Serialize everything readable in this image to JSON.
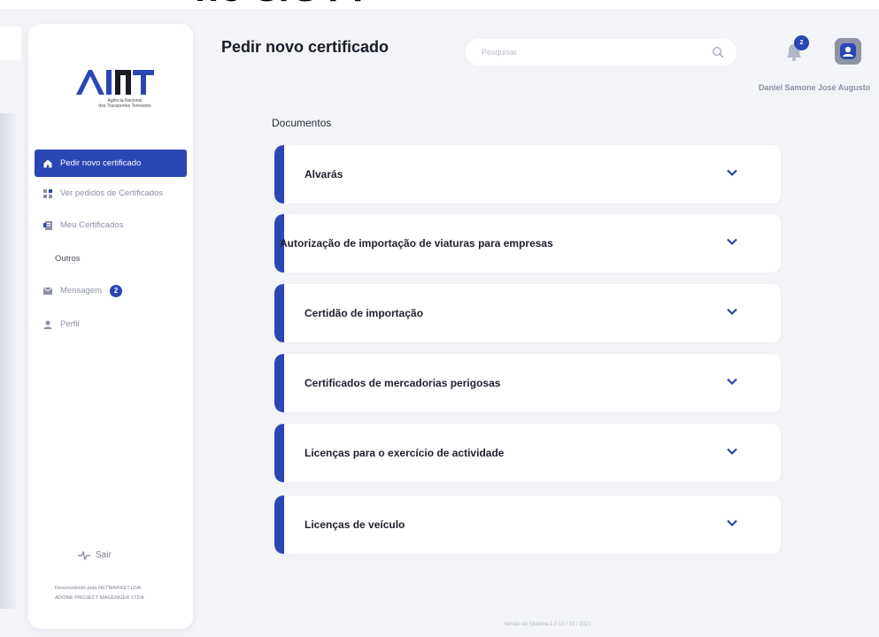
{
  "background": {
    "cut_text": "no siGTT"
  },
  "brand": {
    "logo_text": "ANTT",
    "subtitle_line1": "Agência Nacional",
    "subtitle_line2": "dos Transportes Terrestres",
    "accent": "#2a46b5"
  },
  "sidebar": {
    "items": [
      {
        "label": "Pedir novo certificado",
        "icon": "home-icon",
        "active": true
      },
      {
        "label": "Ver pedidos de Certificados",
        "icon": "grid-icon",
        "active": false
      },
      {
        "label": "Meu Certificados",
        "icon": "certificate-icon",
        "active": false
      }
    ],
    "section_label": "Outros",
    "other_items": [
      {
        "label": "Mensagem",
        "icon": "mail-icon",
        "badge": "2"
      },
      {
        "label": "Perfil",
        "icon": "user-icon"
      }
    ],
    "logout_label": "Sair",
    "credits_line1": "Desenvolvido pela NETMARKET.LDA",
    "credits_line2": "ADONE PROJECT MAGENGER LTDA"
  },
  "header": {
    "title": "Pedir novo certificado",
    "search_placeholder": "Pesquisar",
    "notification_count": "2",
    "user_name": "Daniel Samone José Augusto"
  },
  "main": {
    "section_title": "Documentos",
    "documents": [
      {
        "label": "Alvarás"
      },
      {
        "label": "Autorização de importação de viaturas para empresas"
      },
      {
        "label": "Certidão de importação"
      },
      {
        "label": "Certificados de mercadorias perigosas"
      },
      {
        "label": "Licenças para o exercício de actividade"
      },
      {
        "label": "Licenças de veículo"
      }
    ]
  },
  "footer": {
    "version": "Versão do Sistema 1.0 10 / 10 / 2021"
  }
}
